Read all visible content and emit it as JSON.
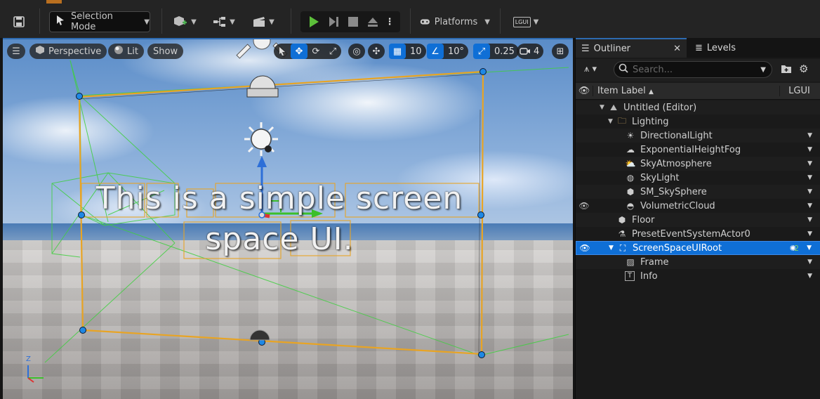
{
  "toolbar": {
    "selection_mode": "Selection Mode",
    "platforms": "Platforms",
    "lgui_badge": "LGUI"
  },
  "viewport": {
    "perspective": "Perspective",
    "lit": "Lit",
    "show": "Show",
    "grid_snap": "10",
    "rot_snap": "10°",
    "scale_snap": "0.25",
    "camera_speed": "4",
    "ui_text_line1": "This is a simple screen",
    "ui_text_line2": "space UI.",
    "axis_z": "Z"
  },
  "outliner": {
    "tab_outliner": "Outliner",
    "tab_levels": "Levels",
    "search_placeholder": "Search...",
    "col_item_label": "Item Label",
    "col_lgui": "LGUI",
    "items": [
      {
        "label": "Untitled (Editor)",
        "icon": "level-icon"
      },
      {
        "label": "Lighting",
        "icon": "folder-icon"
      },
      {
        "label": "DirectionalLight",
        "icon": "directional-light-icon"
      },
      {
        "label": "ExponentialHeightFog",
        "icon": "fog-icon"
      },
      {
        "label": "SkyAtmosphere",
        "icon": "sky-atmosphere-icon"
      },
      {
        "label": "SkyLight",
        "icon": "sky-light-icon"
      },
      {
        "label": "SM_SkySphere",
        "icon": "static-mesh-icon"
      },
      {
        "label": "VolumetricCloud",
        "icon": "cloud-icon"
      },
      {
        "label": "Floor",
        "icon": "static-mesh-icon"
      },
      {
        "label": "PresetEventSystemActor0",
        "icon": "actor-icon"
      },
      {
        "label": "ScreenSpaceUIRoot",
        "icon": "ui-root-icon",
        "extra": "2"
      },
      {
        "label": "Frame",
        "icon": "image-icon"
      },
      {
        "label": "Info",
        "icon": "text-icon"
      }
    ]
  },
  "colors": {
    "accent": "#0f6fd6",
    "selection_outline": "#e8a424",
    "panel_bg": "#1a1a1a"
  }
}
